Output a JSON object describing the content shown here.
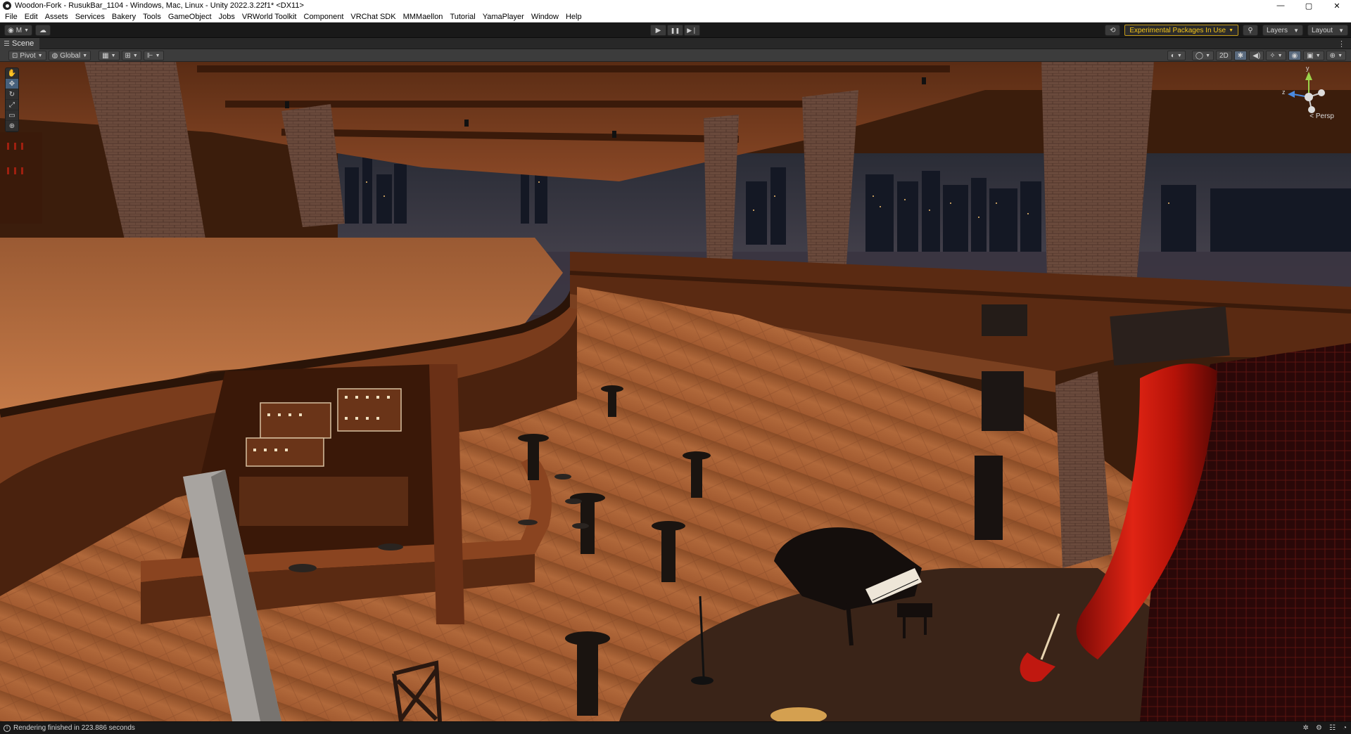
{
  "window": {
    "title": "Woodon-Fork - RusukBar_1104 - Windows, Mac, Linux - Unity 2022.3.22f1* <DX11>",
    "controls": {
      "minimize": "—",
      "maximize": "▢",
      "close": "✕"
    }
  },
  "menu": [
    "File",
    "Edit",
    "Assets",
    "Services",
    "Bakery",
    "Tools",
    "GameObject",
    "Jobs",
    "VRWorld Toolkit",
    "Component",
    "VRChat SDK",
    "MMMaellon",
    "Tutorial",
    "YamaPlayer",
    "Window",
    "Help"
  ],
  "toolbar": {
    "account_label": "M",
    "play": "▶",
    "pause": "❚❚",
    "step": "▶❘",
    "experimental_label": "Experimental Packages In Use",
    "layers_label": "Layers",
    "layout_label": "Layout"
  },
  "scene_tab": {
    "label": "Scene"
  },
  "scene_toolbar": {
    "pivot_label": "Pivot",
    "global_label": "Global",
    "mode_2d": "2D"
  },
  "tools": [
    {
      "name": "view-tool",
      "glyph": "✋"
    },
    {
      "name": "move-tool",
      "glyph": "✥"
    },
    {
      "name": "rotate-tool",
      "glyph": "↻"
    },
    {
      "name": "scale-tool",
      "glyph": "⤢"
    },
    {
      "name": "rect-tool",
      "glyph": "▭"
    },
    {
      "name": "transform-tool",
      "glyph": "⊕"
    }
  ],
  "gizmo": {
    "y_label": "y",
    "z_label": "z",
    "persp_label": "< Persp"
  },
  "status": {
    "message": "Rendering finished in 223.886 seconds"
  },
  "colors": {
    "accent_blue": "#46607c",
    "experimental_yellow": "#f5c518",
    "wood_floor": "#b5683a",
    "curtain_red": "#c41a10"
  }
}
